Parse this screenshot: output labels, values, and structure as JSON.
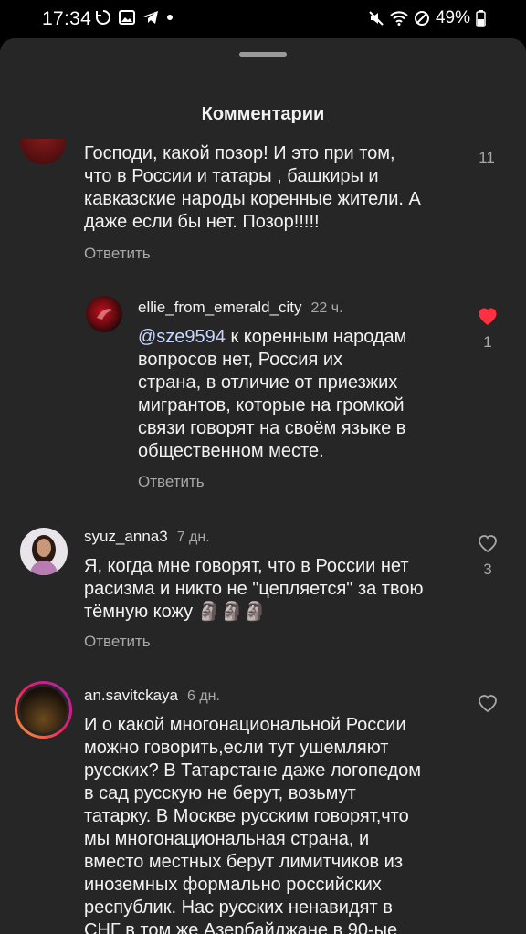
{
  "status": {
    "time": "17:34",
    "battery": "49%"
  },
  "header": {
    "title": "Комментарии"
  },
  "comments": [
    {
      "text": "Господи, какой позор! И это при том, что в России и татары , башкиры и кавказские народы коренные жители. А даже если бы нет. Позор!!!!!",
      "lines": [
        "Господи, какой позор! И это при том,",
        "что в России и татары , башкиры и",
        "кавказские народы коренные жители. А",
        "даже если бы нет. Позор!!!!!"
      ],
      "reply": "Ответить",
      "likes": "11"
    },
    {
      "username": "ellie_from_emerald_city",
      "time": "22 ч.",
      "mention": "@sze9594",
      "lines": [
        " к коренным народам",
        "вопросов нет, Россия их",
        "страна, в отличие от приезжих",
        "мигрантов, которые на громкой",
        "связи говорят на своём языке в",
        "общественном месте."
      ],
      "reply": "Ответить",
      "likes": "1",
      "liked": true
    },
    {
      "username": "syuz_anna3",
      "time": "7 дн.",
      "lines": [
        "Я, когда мне говорят, что в России нет",
        "расизма и никто не \"цепляется\" за твою",
        "тёмную кожу 🗿🗿🗿"
      ],
      "reply": "Ответить",
      "likes": "3"
    },
    {
      "username": "an.savitckaya",
      "time": "6 дн.",
      "lines": [
        "И о какой многонациональной России",
        "можно говорить,если тут ушемляют",
        "русских? В Татарстане даже логопедом",
        "в сад русскую не берут, возьмут",
        "татарку. В Москве русским говорят,что",
        "мы многонациональная страна, и",
        "вместо местных берут лимитчиков из",
        "иноземных формально российских",
        "республик. Нас русских ненавидят в",
        "СНГ в том же Азербайджане в 90-ые"
      ]
    }
  ],
  "colors": {
    "sheet_bg": "#262626",
    "like_red": "#ff3040",
    "secondary_text": "#a8a8a8"
  }
}
